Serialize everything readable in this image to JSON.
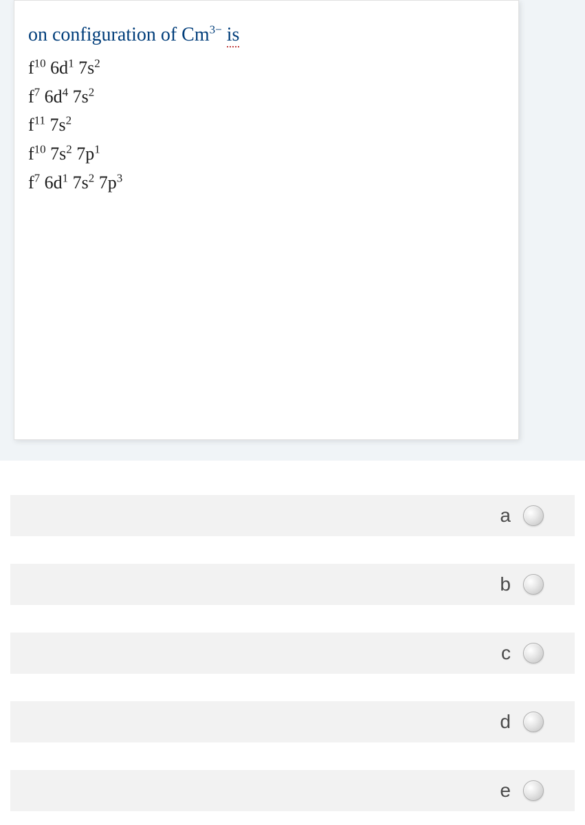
{
  "question": {
    "prefix": "on configuration of Cm",
    "sup": "3−",
    "suffix": " is"
  },
  "configs": [
    {
      "parts": [
        {
          "t": "f",
          "s": "10"
        },
        {
          "t": " 6d",
          "s": "1"
        },
        {
          "t": " 7s",
          "s": "2"
        }
      ]
    },
    {
      "parts": [
        {
          "t": "f",
          "s": "7"
        },
        {
          "t": " 6d",
          "s": "4"
        },
        {
          "t": " 7s",
          "s": "2"
        }
      ]
    },
    {
      "parts": [
        {
          "t": "f",
          "s": "11"
        },
        {
          "t": " 7s",
          "s": "2"
        }
      ]
    },
    {
      "parts": [
        {
          "t": "f",
          "s": "10"
        },
        {
          "t": " 7s",
          "s": "2"
        },
        {
          "t": " 7p",
          "s": "1"
        }
      ]
    },
    {
      "parts": [
        {
          "t": "f",
          "s": "7"
        },
        {
          "t": " 6d",
          "s": "1"
        },
        {
          "t": " 7s",
          "s": "2"
        },
        {
          "t": " 7p",
          "s": "3"
        }
      ]
    }
  ],
  "answers": [
    {
      "label": "a"
    },
    {
      "label": "b"
    },
    {
      "label": "c"
    },
    {
      "label": "d"
    },
    {
      "label": "e"
    }
  ]
}
